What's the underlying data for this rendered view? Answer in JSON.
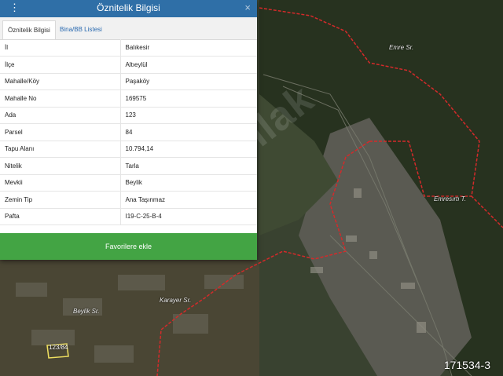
{
  "panel": {
    "title": "Öznitelik Bilgisi",
    "tabs": [
      {
        "label": "Öznitelik Bilgisi",
        "active": true
      },
      {
        "label": "Bina/BB Listesi",
        "active": false
      }
    ],
    "rows": [
      {
        "key": "İl",
        "value": "Balıkesir"
      },
      {
        "key": "İlçe",
        "value": "Altıeylül"
      },
      {
        "key": "Mahalle/Köy",
        "value": "Paşaköy"
      },
      {
        "key": "Mahalle No",
        "value": "169575"
      },
      {
        "key": "Ada",
        "value": "123"
      },
      {
        "key": "Parsel",
        "value": "84"
      },
      {
        "key": "Tapu Alanı",
        "value": "10.794,14"
      },
      {
        "key": "Nitelik",
        "value": "Tarla"
      },
      {
        "key": "Mevkii",
        "value": "Beylik"
      },
      {
        "key": "Zemin Tip",
        "value": "Ana Taşınmaz"
      },
      {
        "key": "Pafta",
        "value": "I19-C-25-B-4"
      }
    ],
    "favorite_button": "Favorilere ekle",
    "header_color": "#2f6fa7",
    "button_color": "#43a444"
  },
  "map": {
    "labels": {
      "emre": "Emre Sr.",
      "emresirti": "Emresırtı T.",
      "karayer": "Karayer Sr.",
      "beylik": "Beylik Sr.",
      "parcel": "123/84"
    },
    "watermark": "hepsiemlak",
    "boundary_color": "#d42a2a",
    "parcel_color": "#f0e060"
  },
  "listing_code": "171534-3",
  "icons": {
    "menu": "menu-dots-icon",
    "close": "close-icon"
  }
}
